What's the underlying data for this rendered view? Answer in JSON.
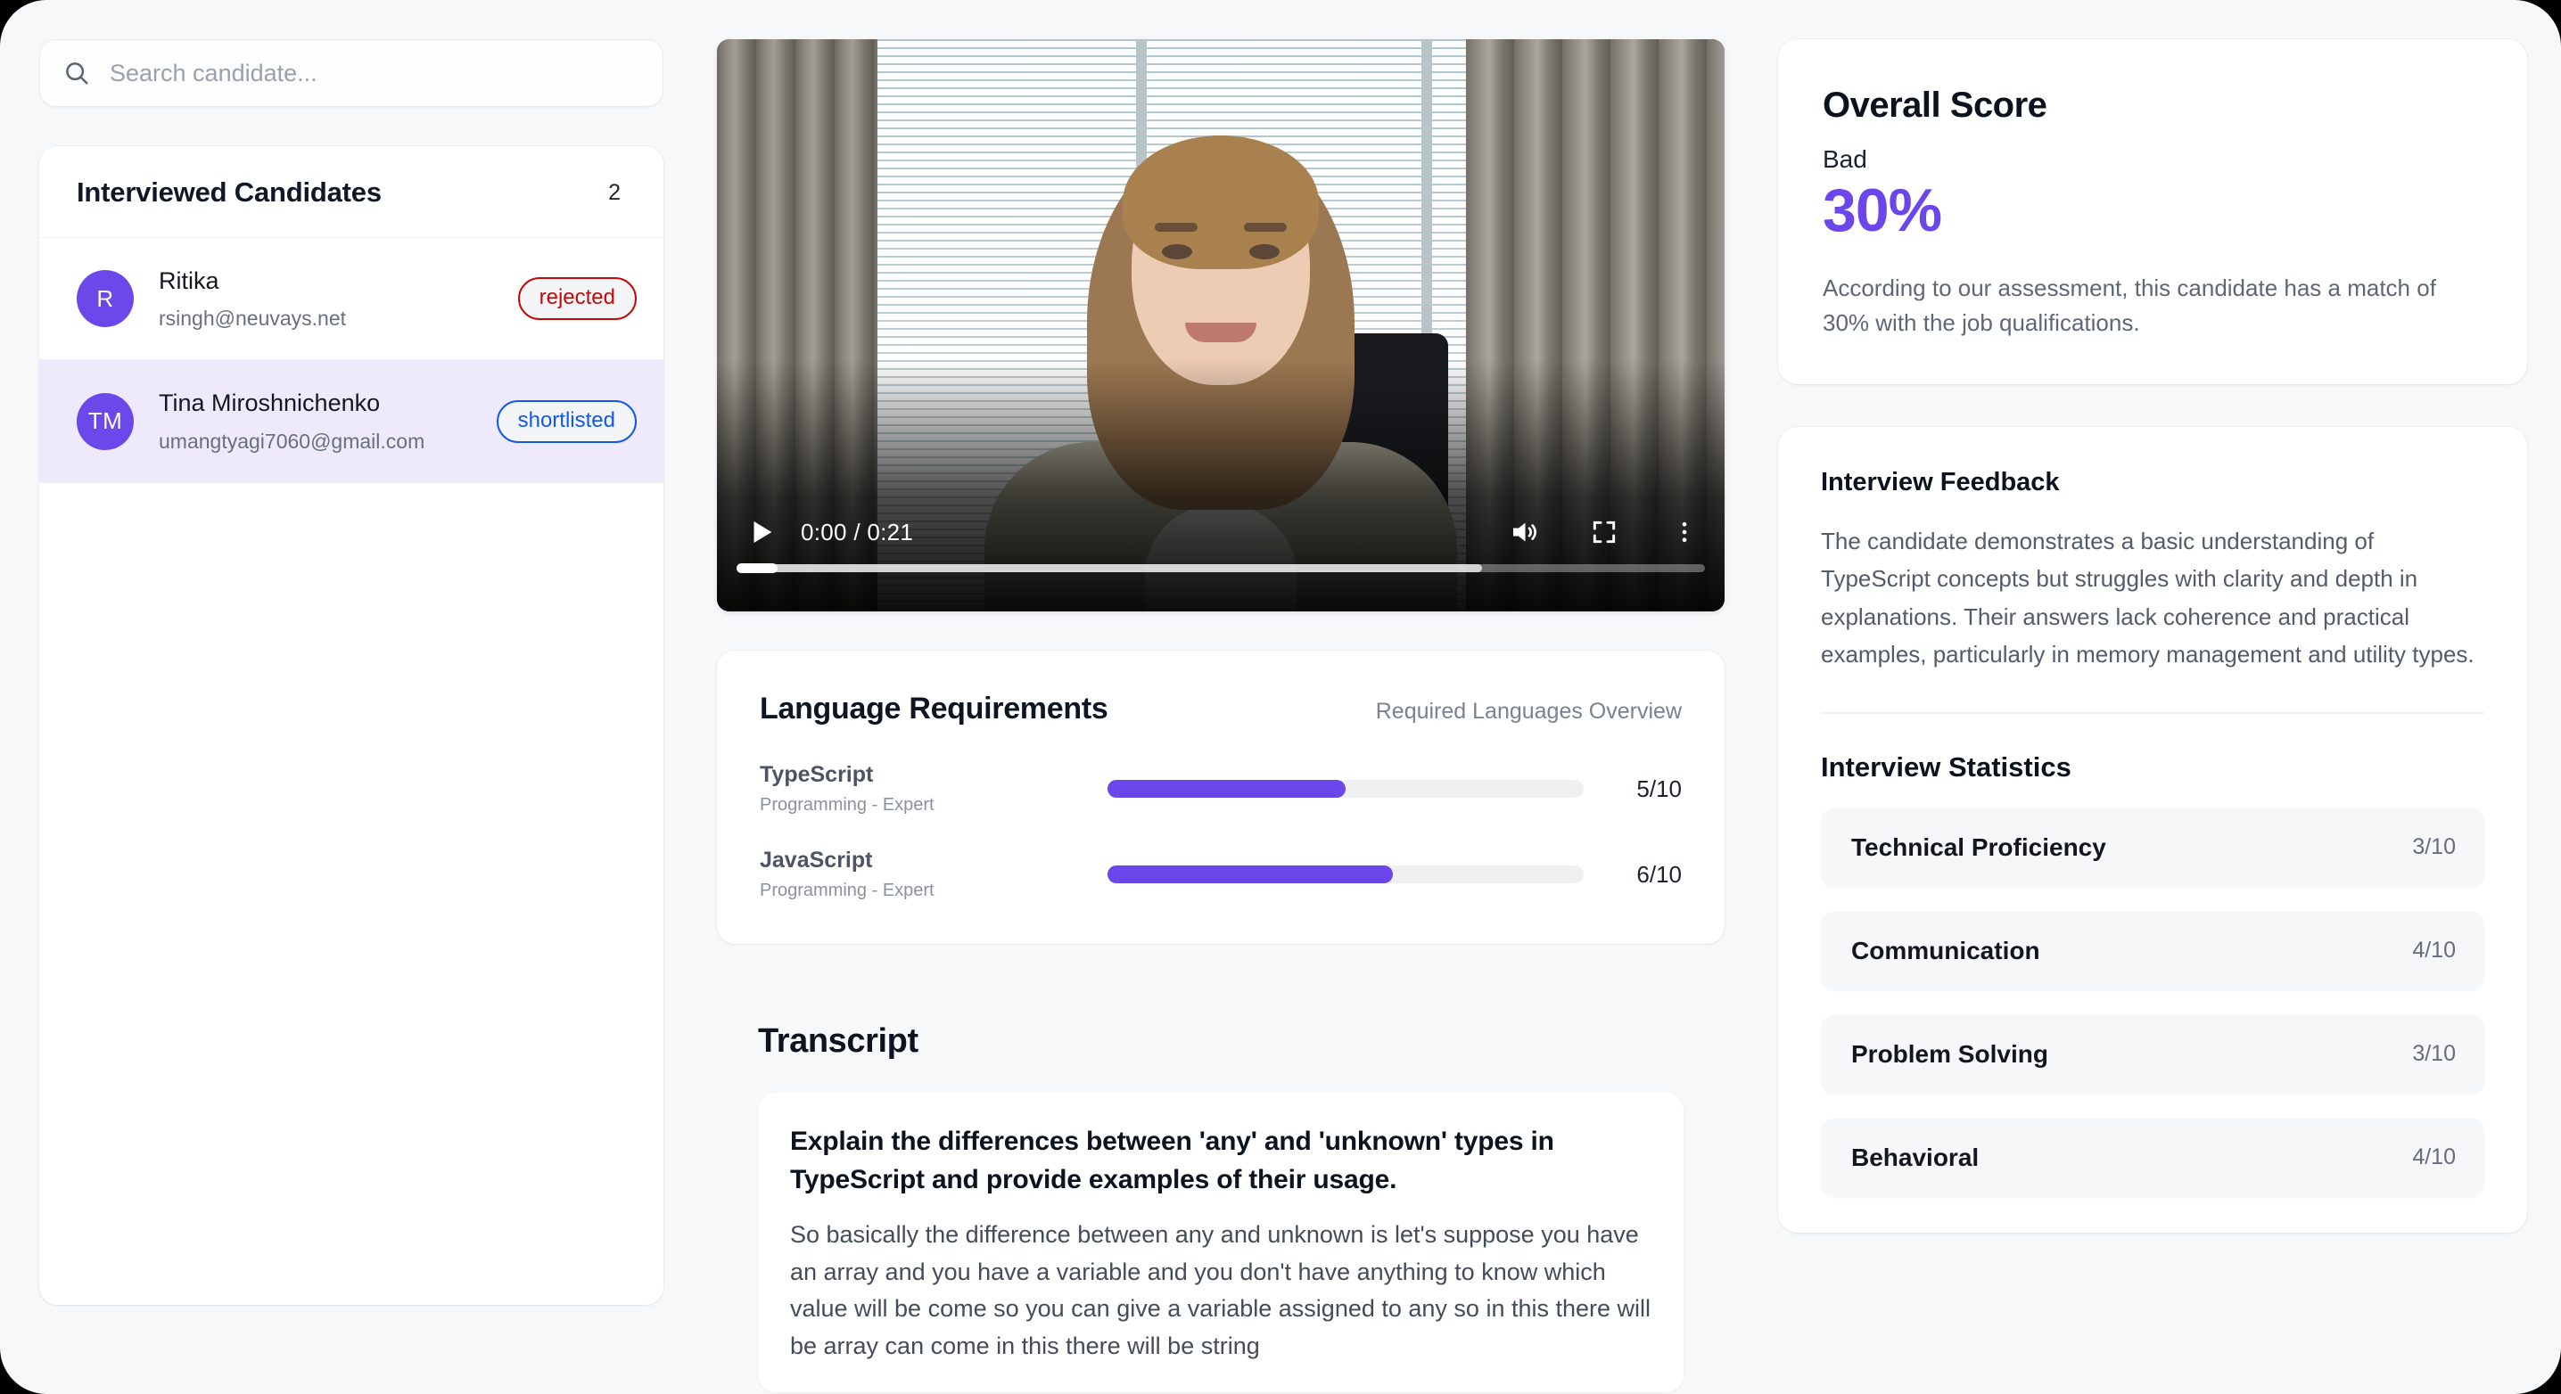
{
  "search": {
    "placeholder": "Search candidate...",
    "value": "",
    "icon": "search-icon"
  },
  "candidates_panel": {
    "title": "Interviewed Candidates",
    "count": "2",
    "items": [
      {
        "initials": "R",
        "name": "Ritika",
        "email": "rsingh@neuvays.net",
        "status": "rejected",
        "status_color": "#c50a0a",
        "selected": false
      },
      {
        "initials": "TM",
        "name": "Tina Miroshnichenko",
        "email": "umangtyagi7060@gmail.com",
        "status": "shortlisted",
        "status_color": "#1358e8",
        "selected": true
      }
    ]
  },
  "video": {
    "current_time": "0:00",
    "duration": "0:21",
    "time_display": "0:00 / 0:21",
    "play_icon": "play-icon",
    "volume_icon": "volume-icon",
    "fullscreen_icon": "fullscreen-icon",
    "more_icon": "more-options-icon",
    "progress_percent": 0,
    "buffered_percent": 77
  },
  "language_requirements": {
    "title": "Language Requirements",
    "subtitle": "Required Languages Overview",
    "items": [
      {
        "name": "TypeScript",
        "meta": "Programming - Expert",
        "score": "5/10",
        "value": 5,
        "max": 10,
        "percent": 50
      },
      {
        "name": "JavaScript",
        "meta": "Programming - Expert",
        "score": "6/10",
        "value": 6,
        "max": 10,
        "percent": 60
      }
    ],
    "bar_color": "#6b46ea"
  },
  "transcript": {
    "title": "Transcript",
    "entries": [
      {
        "question": "Explain the differences between 'any' and 'unknown' types in TypeScript and provide examples of their usage.",
        "answer": "So basically the difference between any and unknown is let's suppose you have an array and you have a variable and you don't have anything to know which value will be come so you can give a variable assigned to any so in this there will be array can come in this there will be string"
      }
    ]
  },
  "overall_score": {
    "title": "Overall Score",
    "rating_label": "Bad",
    "percent": "30%",
    "percent_color": "#6b46ea",
    "description": "According to our assessment, this candidate has a match of 30% with the job qualifications."
  },
  "interview_feedback": {
    "title": "Interview Feedback",
    "text": "The candidate demonstrates a basic understanding of TypeScript concepts but struggles with clarity and depth in explanations. Their answers lack coherence and practical examples, particularly in memory management and utility types."
  },
  "interview_statistics": {
    "title": "Interview Statistics",
    "rows": [
      {
        "name": "Technical Proficiency",
        "score": "3/10"
      },
      {
        "name": "Communication",
        "score": "4/10"
      },
      {
        "name": "Problem Solving",
        "score": "3/10"
      },
      {
        "name": "Behavioral",
        "score": "4/10"
      }
    ]
  }
}
